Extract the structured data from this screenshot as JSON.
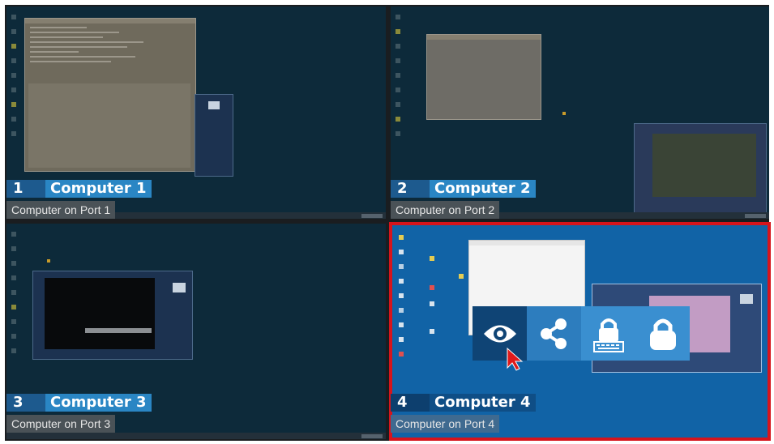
{
  "panes": [
    {
      "number": "1",
      "name": "Computer 1",
      "port": "Computer on Port 1"
    },
    {
      "number": "2",
      "name": "Computer 2",
      "port": "Computer on Port 2"
    },
    {
      "number": "3",
      "name": "Computer 3",
      "port": "Computer on Port 3"
    },
    {
      "number": "4",
      "name": "Computer 4",
      "port": "Computer on Port 4"
    }
  ],
  "selected_pane": 4,
  "highlight_color": "#d6141c",
  "toolbar": {
    "icons": [
      "eye-icon",
      "share-icon",
      "keyboard-lock-icon",
      "lock-icon"
    ]
  }
}
